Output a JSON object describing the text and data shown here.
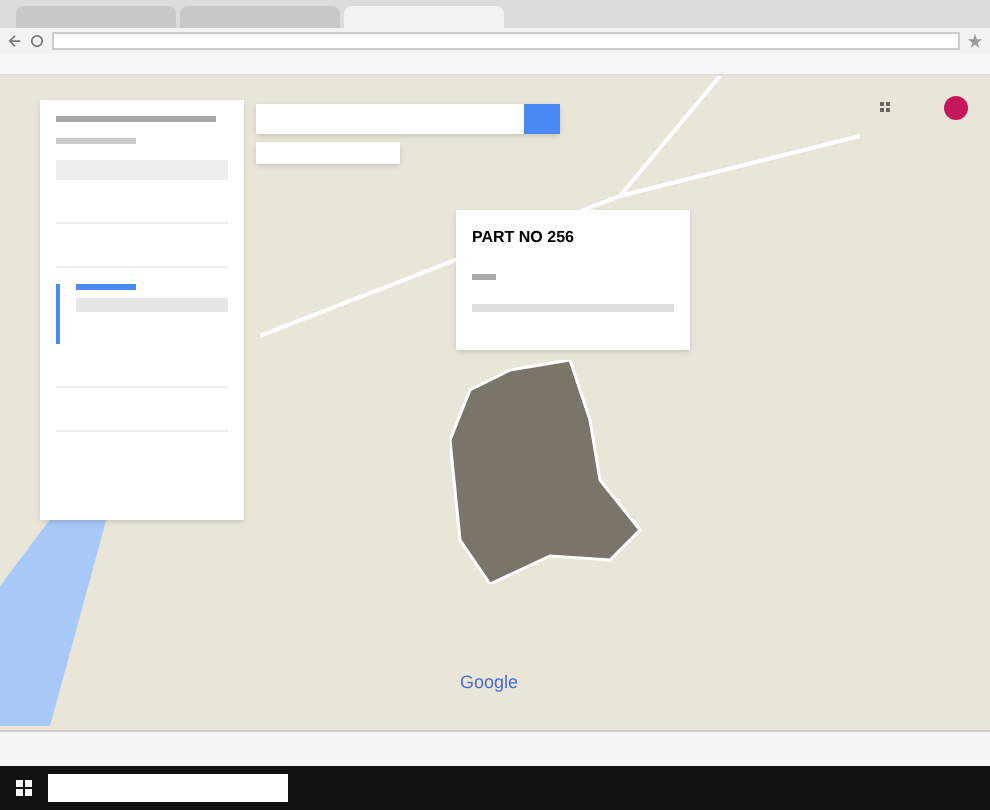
{
  "map": {
    "popup": {
      "title": "PART NO 256"
    },
    "logo": "Google"
  },
  "tabs": [
    {
      "selected": false
    },
    {
      "selected": false
    },
    {
      "selected": true
    }
  ]
}
